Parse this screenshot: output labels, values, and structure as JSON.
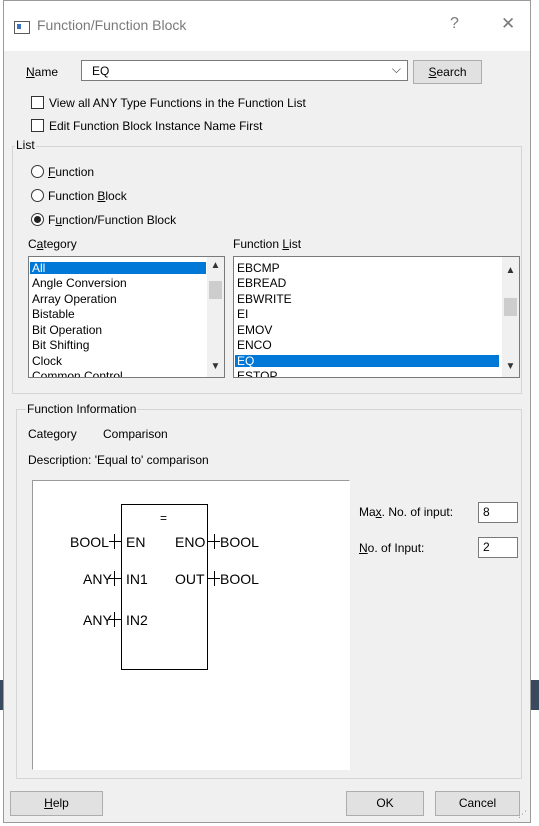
{
  "dialog": {
    "title": "Function/Function Block",
    "help_glyph": "?",
    "close_glyph": "✕"
  },
  "name_field": {
    "label_prefix": "",
    "label_accel": "N",
    "label_rest": "ame",
    "value": "EQ",
    "search_accel": "S",
    "search_rest": "earch"
  },
  "options": {
    "view_all_any": {
      "label": "View all ANY Type Functions in the Function List",
      "checked": false
    },
    "edit_fb_first": {
      "label": "Edit Function Block Instance Name First",
      "checked": false
    }
  },
  "list_group": {
    "title": "List",
    "radios": [
      {
        "pre": "",
        "accel": "F",
        "post": "unction",
        "checked": false
      },
      {
        "pre": "Function ",
        "accel": "B",
        "post": "lock",
        "checked": false
      },
      {
        "pre": "F",
        "accel": "u",
        "post": "nction/Function Block",
        "checked": true
      }
    ],
    "category_label_pre": "C",
    "category_label_accel": "a",
    "category_label_post": "tegory",
    "function_list_label_pre": "Function ",
    "function_list_label_accel": "L",
    "function_list_label_post": "ist",
    "categories": [
      "All",
      "Angle Conversion",
      "Array Operation",
      "Bistable",
      "Bit Operation",
      "Bit Shifting",
      "Clock",
      "Common Control"
    ],
    "categories_selected": 0,
    "functions": [
      "EBCMP",
      "EBREAD",
      "EBWRITE",
      "EI",
      "EMOV",
      "ENCO",
      "EQ",
      "ESTOP"
    ],
    "functions_selected": 6
  },
  "function_info": {
    "title": "Function Information",
    "category_label": "Category",
    "category_value": "Comparison",
    "description": "Description:  'Equal to' comparison",
    "block": {
      "symbol": "=",
      "left_inputs": [
        {
          "type": "BOOL",
          "pin": "EN"
        },
        {
          "type": "ANY",
          "pin": "IN1"
        },
        {
          "type": "ANY",
          "pin": "IN2"
        }
      ],
      "right_outputs": [
        {
          "pin": "ENO",
          "type": "BOOL"
        },
        {
          "pin": "OUT",
          "type": "BOOL"
        }
      ]
    },
    "max_inputs_label_pre": "Ma",
    "max_inputs_label_accel": "x",
    "max_inputs_label_post": ". No. of input:",
    "max_inputs_value": "8",
    "num_inputs_label_pre": "",
    "num_inputs_label_accel": "N",
    "num_inputs_label_post": "o. of Input:",
    "num_inputs_value": "2"
  },
  "buttons": {
    "help_accel": "H",
    "help_rest": "elp",
    "ok": "OK",
    "cancel": "Cancel"
  }
}
